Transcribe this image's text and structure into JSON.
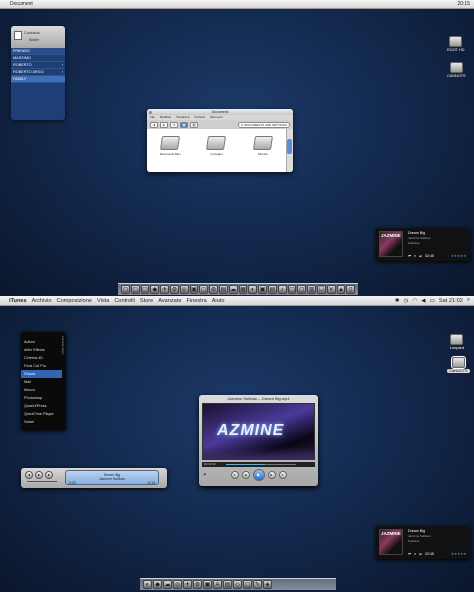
{
  "top": {
    "menubar": {
      "app": "Document",
      "clock": "20:15"
    },
    "desktop_icons": [
      {
        "label": "ROOT HD",
        "icon": "hard-drive-icon"
      },
      {
        "label": "CANNOTS",
        "icon": "hard-drive-icon"
      }
    ],
    "contacts": {
      "title": "Contacts",
      "subtitle": "Walter",
      "rows": [
        "FRIENDS",
        "MASSIMO",
        "ROBERTO",
        "ROBERTO ARGO",
        "FAMILY"
      ],
      "selected": "FAMILY"
    },
    "finder": {
      "title": "Documenti",
      "menu": [
        "File",
        "Modifica",
        "Visualizza",
        "Preferiti",
        "Strumenti"
      ],
      "address": "C:\\DOCUMENTS AND SETTINGS",
      "files": [
        "Documenti Miei",
        "Immagini",
        "Musica"
      ]
    },
    "now_playing": {
      "art_text": "JAZMINE",
      "track": "Dream Big",
      "artist": "Jazmine Sullivan",
      "album": "Fearless",
      "time": "02:45",
      "stars": "★★★★★"
    },
    "dock_icons": [
      "▢",
      "▢",
      "▢",
      "◆",
      "✈",
      "⚙",
      "◎",
      "▣",
      "▢",
      "⚙",
      "▤",
      "☁",
      "▦",
      "◐",
      "▣",
      "▤",
      "♪",
      "▢",
      "▢",
      "▥",
      "☐",
      "✕",
      "▲",
      "▯"
    ]
  },
  "bottom": {
    "menubar": {
      "items": [
        "iTunes",
        "Archivio",
        "Composizione",
        "Vista",
        "Controlli",
        "Store",
        "Avanzate",
        "Finestra",
        "Aiuto"
      ],
      "clock": "Sat 21:02"
    },
    "desktop_icons": [
      {
        "label": "Leopard",
        "icon": "hard-drive-icon"
      },
      {
        "label": "CANNOTS",
        "icon": "hard-drive-icon"
      }
    ],
    "launcher": {
      "title": "Favorite Apps",
      "apps": [
        "Adium",
        "After Effects",
        "Cinema 4D",
        "Final Cut Pro",
        "iTunes",
        "Mail",
        "Mocco",
        "Photoshop",
        "QuarkXPress",
        "QuickTime Player",
        "Safari"
      ],
      "selected": "iTunes"
    },
    "mini_player": {
      "track": "Dream Big",
      "artist": "Jazmine Sullivan",
      "elapsed": "0:32",
      "remaining": "-4:13"
    },
    "video_player": {
      "title": "Jazmine Sullivan – Dream Big.mp4",
      "screen_text": "AZMINE",
      "elapsed": "00:03:12",
      "progress": 0.55
    },
    "now_playing": {
      "art_text": "JAZMINE",
      "track": "Dream Big",
      "artist": "Jazmine Sullivan",
      "album": "Fearless",
      "time": "02:45",
      "stars": "★★★★★"
    },
    "dock_icons": [
      "◐",
      "◆",
      "☁",
      "◎",
      "✈",
      "⚙",
      "▣",
      "A",
      "▤",
      "◇",
      "▢",
      "✎",
      "◈"
    ]
  }
}
